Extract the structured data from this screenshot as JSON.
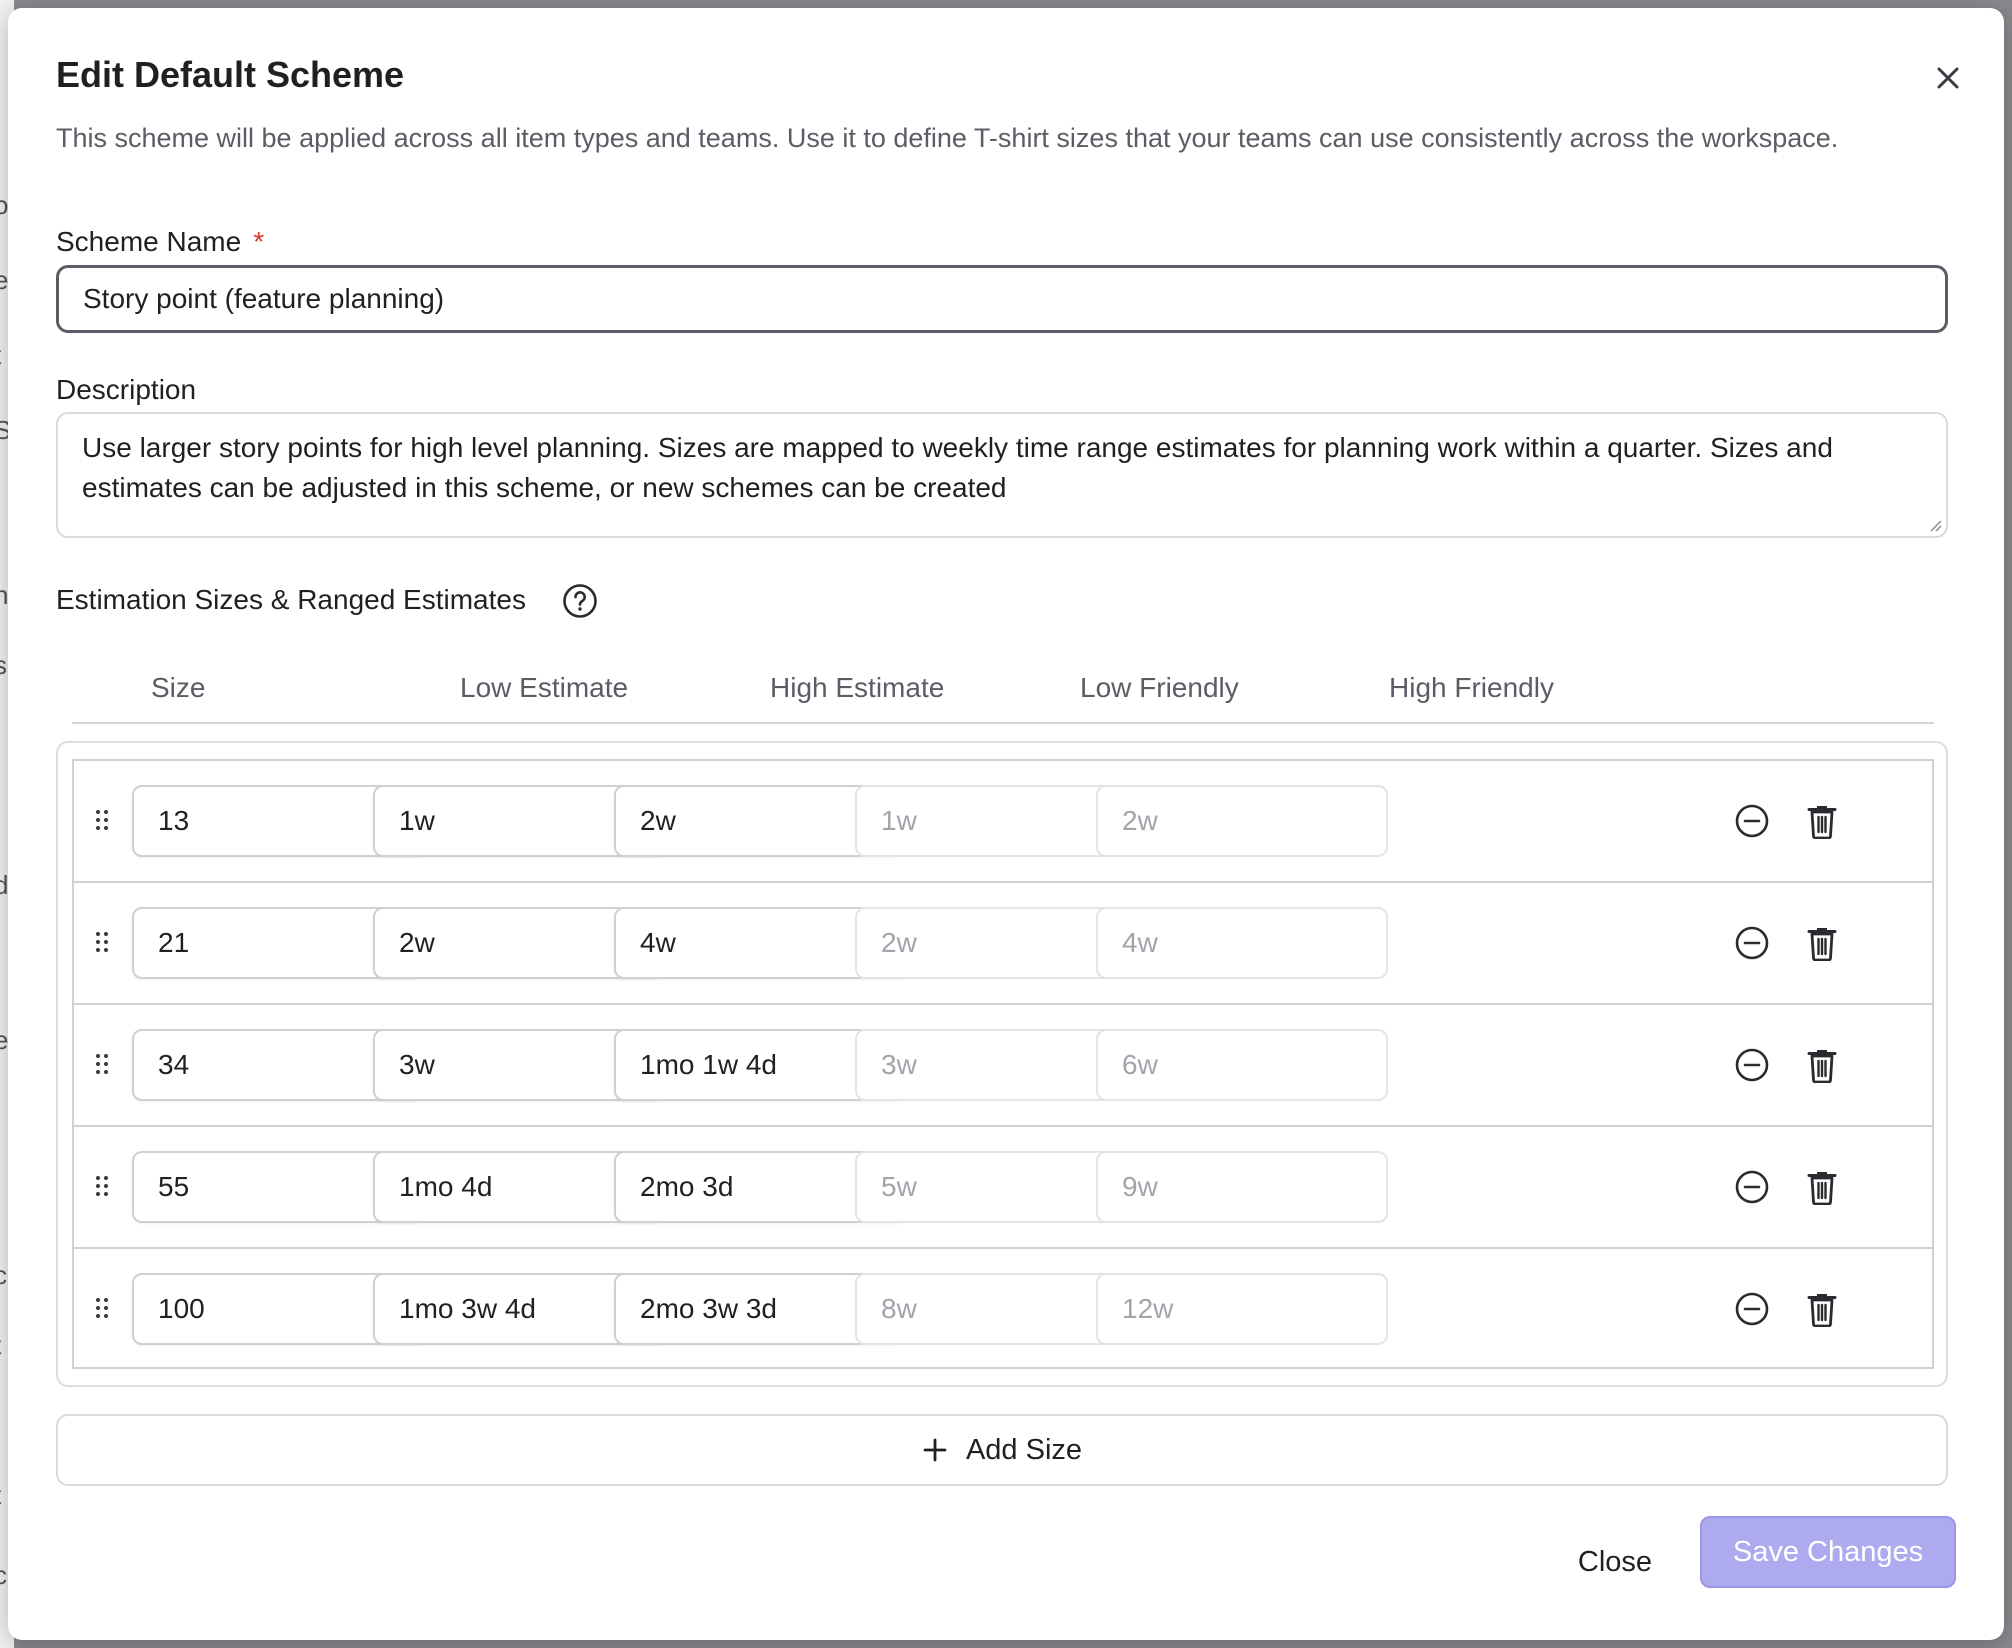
{
  "dialog": {
    "title": "Edit Default Scheme",
    "description": "This scheme will be applied across all item types and teams. Use it to define T-shirt sizes that your teams can use consistently across the workspace."
  },
  "scheme_name": {
    "label": "Scheme Name",
    "required_mark": "*",
    "value": "Story point (feature planning)"
  },
  "description_field": {
    "label": "Description",
    "value": "Use larger story points for high level planning. Sizes are mapped to weekly time range estimates for planning work within a quarter. Sizes and estimates can be adjusted in this scheme, or new schemes can be created"
  },
  "estimation": {
    "section_label": "Estimation Sizes & Ranged Estimates",
    "columns": [
      "Size",
      "Low Estimate",
      "High Estimate",
      "Low Friendly",
      "High Friendly"
    ],
    "rows": [
      {
        "size": "13",
        "low": "1w",
        "high": "2w",
        "low_friendly": "1w",
        "high_friendly": "2w"
      },
      {
        "size": "21",
        "low": "2w",
        "high": "4w",
        "low_friendly": "2w",
        "high_friendly": "4w"
      },
      {
        "size": "34",
        "low": "3w",
        "high": "1mo 1w 4d",
        "low_friendly": "3w",
        "high_friendly": "6w"
      },
      {
        "size": "55",
        "low": "1mo 4d",
        "high": "2mo 3d",
        "low_friendly": "5w",
        "high_friendly": "9w"
      },
      {
        "size": "100",
        "low": "1mo 3w 4d",
        "high": "2mo 3w 3d",
        "low_friendly": "8w",
        "high_friendly": "12w"
      }
    ],
    "add_label": "Add Size"
  },
  "footer": {
    "close_label": "Close",
    "save_label": "Save Changes"
  },
  "colors": {
    "primary_disabled": "#aeaaf0",
    "required": "#d23b30",
    "text_muted": "#5b5c66"
  },
  "icons": [
    "close-icon",
    "help-icon",
    "drag-handle-icon",
    "remove-circle-icon",
    "trash-icon",
    "plus-icon"
  ]
}
